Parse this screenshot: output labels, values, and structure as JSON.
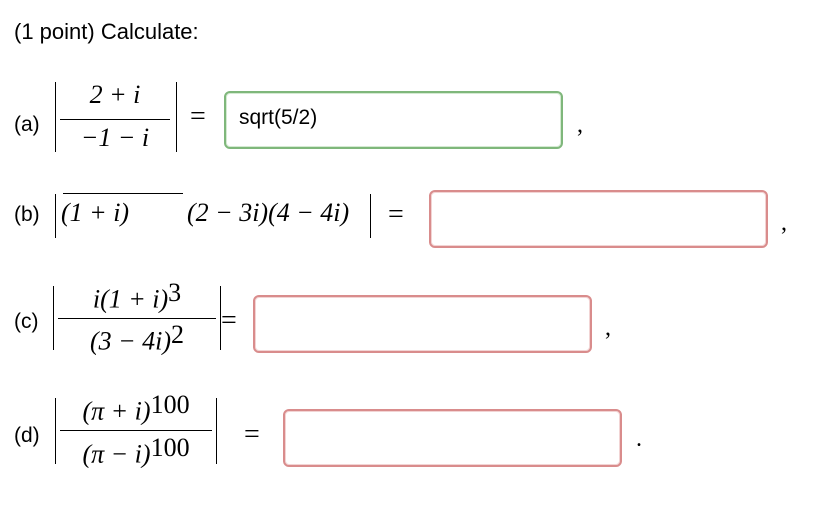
{
  "header": {
    "title": "(1 point) Calculate:"
  },
  "parts": [
    {
      "label": "(a)",
      "numerator": "2 + i",
      "denominator": "−1 − i",
      "equals": "=",
      "answer": "sqrt(5/2)",
      "after": ","
    },
    {
      "label": "(b)",
      "expr_a": "(1 + i)",
      "expr_b": "(2 − 3i)(4 − 4i)",
      "equals": "=",
      "answer": "",
      "after": ","
    },
    {
      "label": "(c)",
      "numerator": "i(1 + i)",
      "numerator_exp": "3",
      "denominator": "(3 − 4i)",
      "denominator_exp": "2",
      "equals": "=",
      "answer": "",
      "after": ","
    },
    {
      "label": "(d)",
      "numerator": "(π + i)",
      "numerator_exp": "100",
      "denominator": "(π − i)",
      "denominator_exp": "100",
      "equals": "=",
      "answer": "",
      "after": "."
    }
  ],
  "colors": {
    "correct_border": "#7fb77b",
    "incorrect_border": "#d98c8c"
  }
}
